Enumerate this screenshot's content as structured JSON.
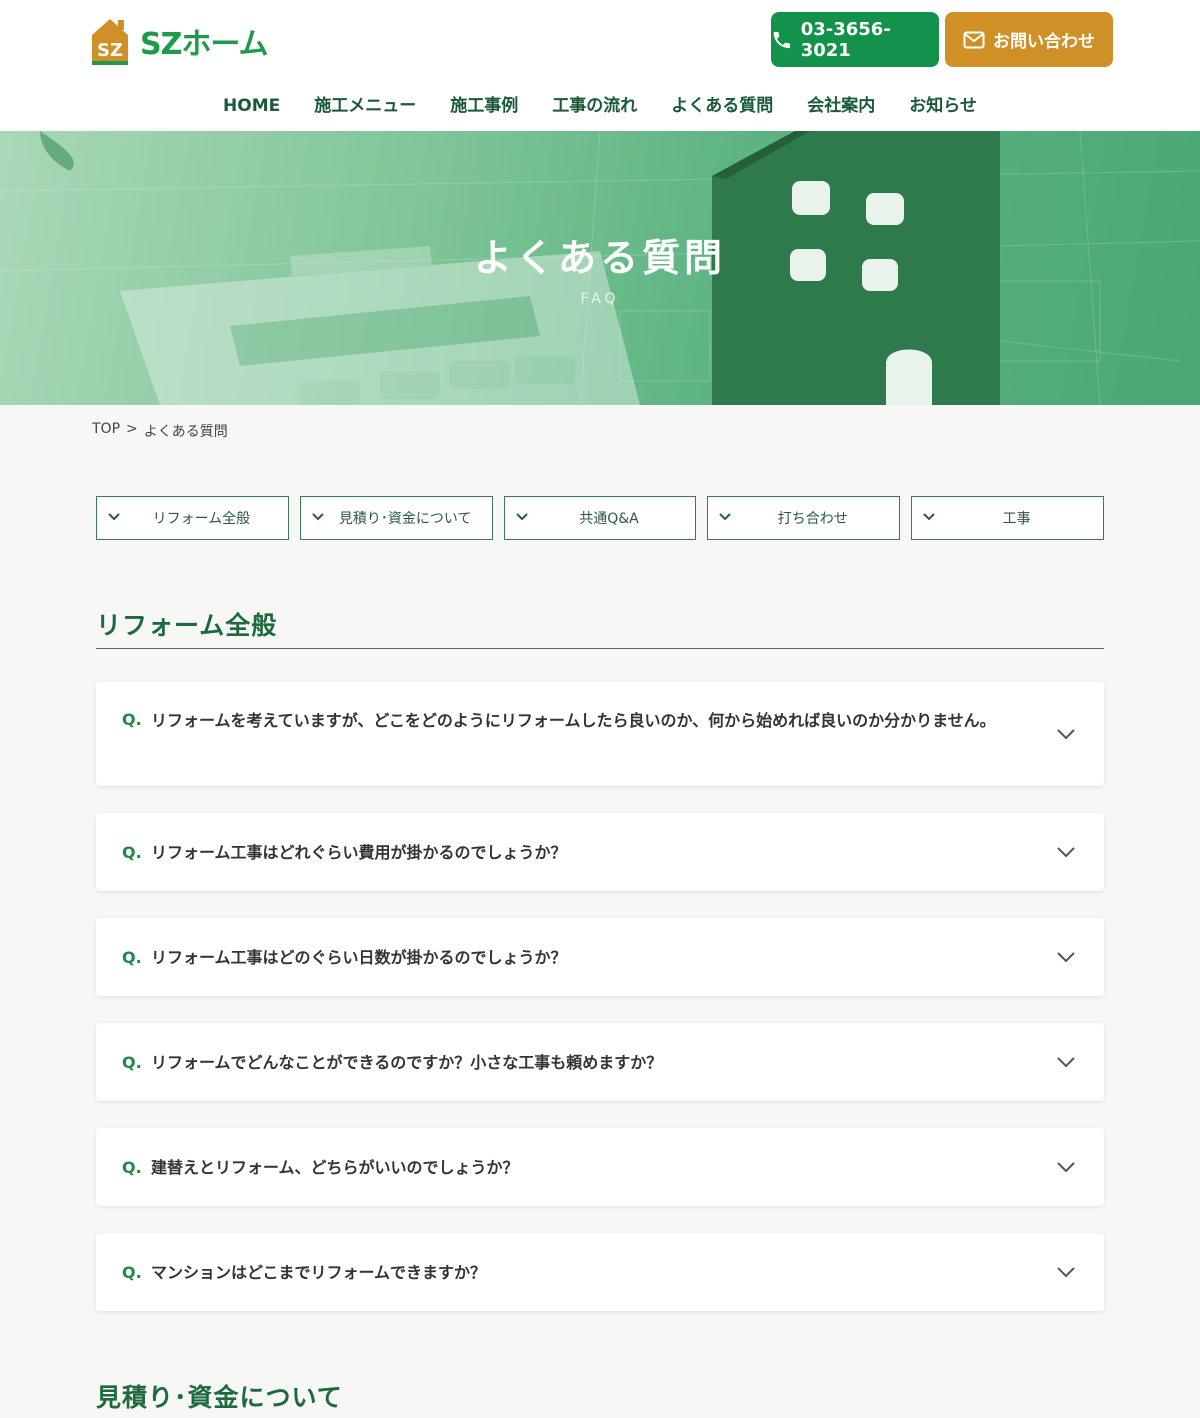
{
  "header": {
    "logo_text": "SZホーム",
    "logo_badge": "SZ",
    "phone": "03-3656-3021",
    "contact_label": "お問い合わせ"
  },
  "nav": {
    "items": [
      "HOME",
      "施工メニュー",
      "施工事例",
      "工事の流れ",
      "よくある質問",
      "会社案内",
      "お知らせ"
    ]
  },
  "hero": {
    "title": "よくある質問",
    "subtitle": "FAQ"
  },
  "breadcrumb": {
    "home": "TOP",
    "separator": ">",
    "current": "よくある質問"
  },
  "tabs": [
    "リフォーム全般",
    "見積り･資金について",
    "共通Q&A",
    "打ち合わせ",
    "工事"
  ],
  "sections": [
    {
      "title": "リフォーム全般",
      "faqs": [
        {
          "prefix": "Q.",
          "question": "リフォームを考えていますが、どこをどのようにリフォームしたら良いのか、何から始めれば良いのか分かりません。"
        },
        {
          "prefix": "Q.",
          "question": "リフォーム工事はどれぐらい費用が掛かるのでしょうか？"
        },
        {
          "prefix": "Q.",
          "question": "リフォーム工事はどのぐらい日数が掛かるのでしょうか？"
        },
        {
          "prefix": "Q.",
          "question": "リフォームでどんなことができるのですか？小さな工事も頼めますか？"
        },
        {
          "prefix": "Q.",
          "question": "建替えとリフォーム、どちらがいいのでしょうか？"
        },
        {
          "prefix": "Q.",
          "question": "マンションはどこまでリフォームできますか？"
        }
      ]
    },
    {
      "title": "見積り･資金について"
    }
  ],
  "colors": {
    "brand_green": "#12924a",
    "accent_orange": "#d09028",
    "dark_green": "#1e6a3f"
  }
}
